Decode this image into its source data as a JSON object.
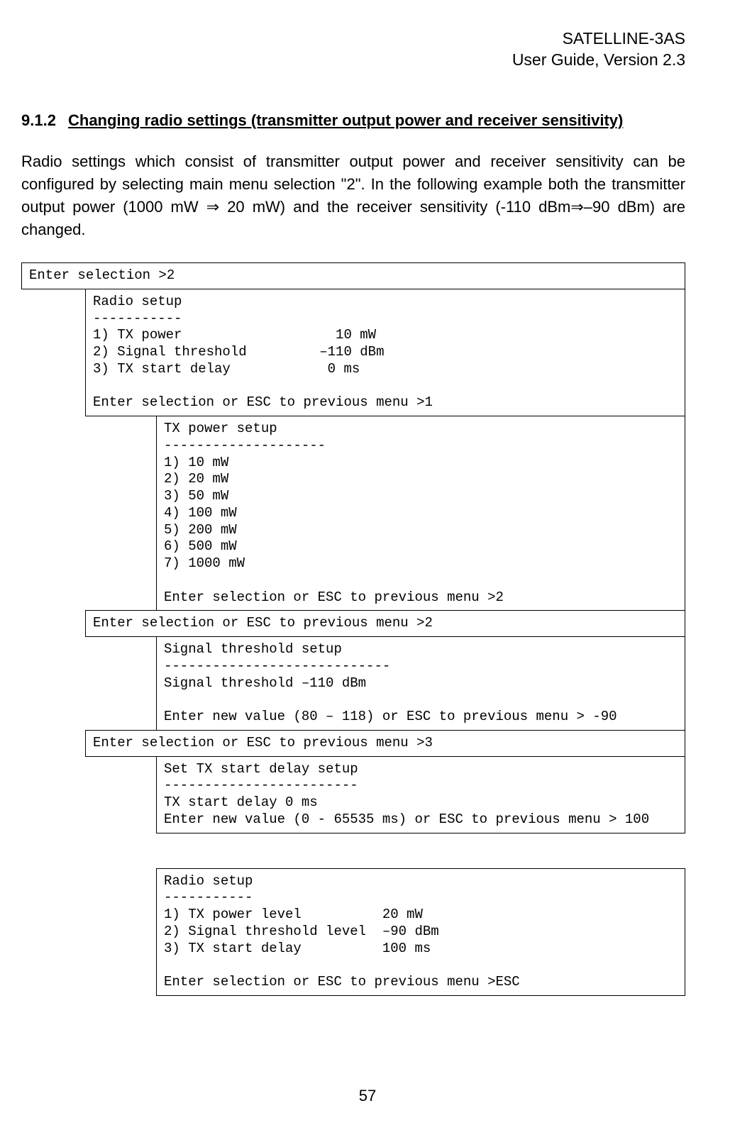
{
  "header": {
    "line1": "SATELLINE-3AS",
    "line2": "User Guide, Version 2.3"
  },
  "section": {
    "number": "9.1.2",
    "title": "Changing radio settings (transmitter output power and receiver sensitivity)"
  },
  "body_paragraph": "Radio settings which consist of transmitter output power and receiver sensitivity can be configured by selecting main menu selection \"2\". In the following example both the transmitter output power (1000 mW ⇒ 20 mW) and the receiver sensitivity (-110 dBm⇒–90 dBm) are changed.",
  "boxes": {
    "b0": "Enter selection >2",
    "b1": "Radio setup\n-----------\n1) TX power                   10 mW\n2) Signal threshold         –110 dBm\n3) TX start delay            0 ms\n\nEnter selection or ESC to previous menu >1",
    "b2": "TX power setup\n--------------------\n1) 10 mW\n2) 20 mW\n3) 50 mW\n4) 100 mW\n5) 200 mW\n6) 500 mW\n7) 1000 mW\n\nEnter selection or ESC to previous menu >2",
    "b3": "Enter selection or ESC to previous menu >2",
    "b4": "Signal threshold setup\n----------------------------\nSignal threshold –110 dBm\n\nEnter new value (80 – 118) or ESC to previous menu > -90",
    "b5": "Enter selection or ESC to previous menu >3",
    "b6": "Set TX start delay setup\n------------------------\nTX start delay 0 ms\nEnter new value (0 - 65535 ms) or ESC to previous menu > 100",
    "b7": "Radio setup\n-----------\n1) TX power level          20 mW\n2) Signal threshold level  –90 dBm\n3) TX start delay          100 ms\n\nEnter selection or ESC to previous menu >ESC"
  },
  "page_number": "57"
}
